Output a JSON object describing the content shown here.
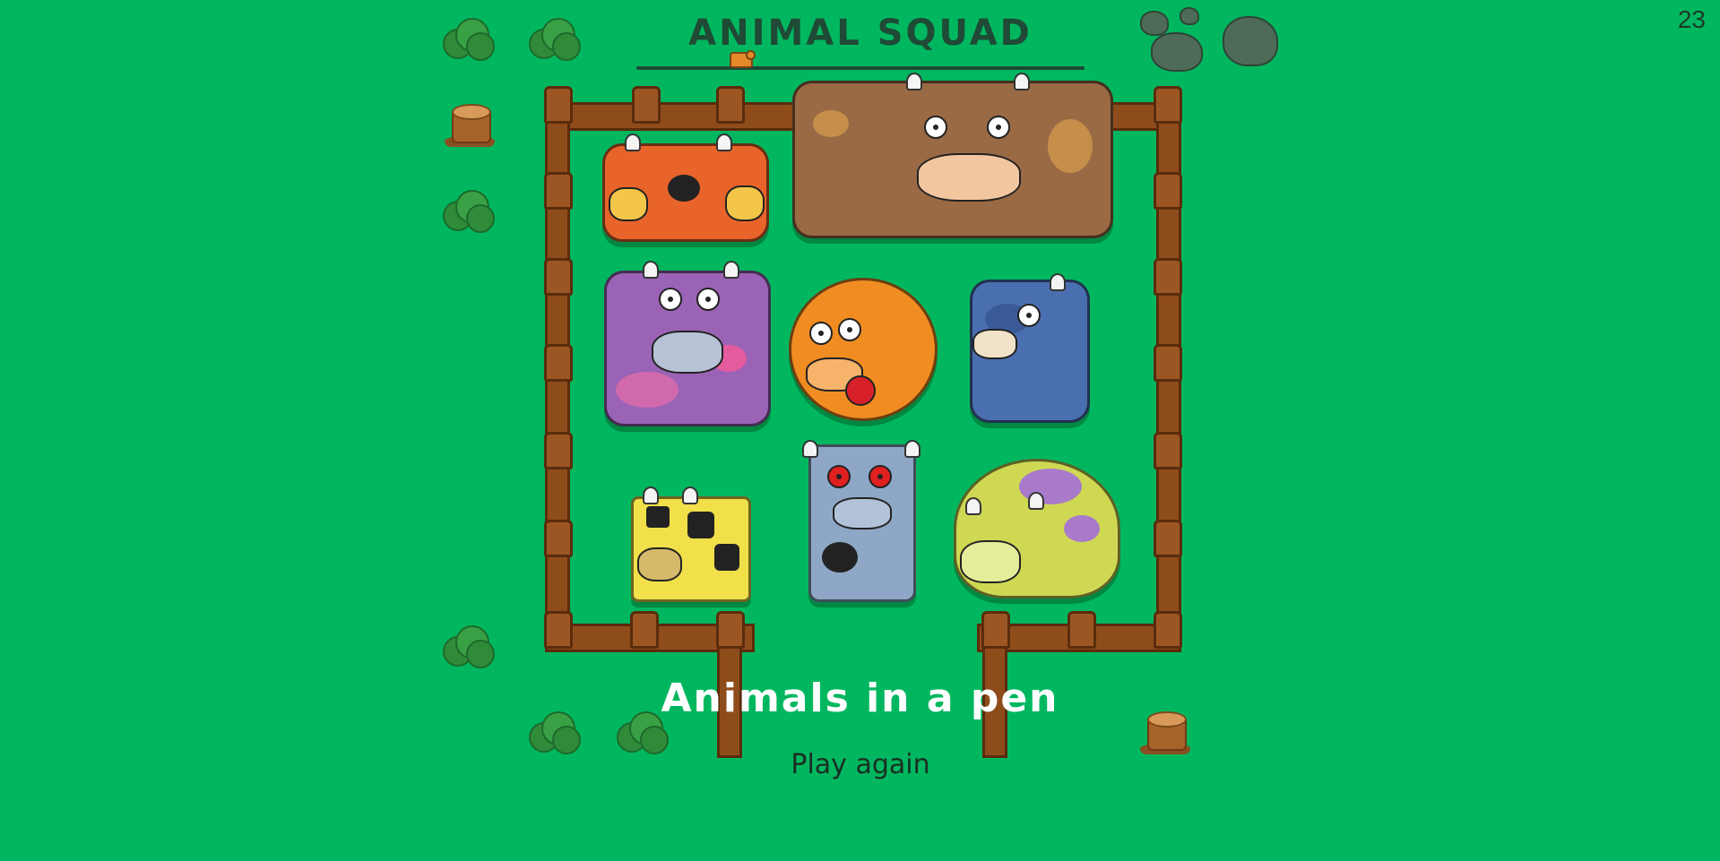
{
  "game": {
    "title": "ANIMAL SQUAD",
    "counter": "23",
    "progress": 0.23
  },
  "result": {
    "message": "Animals in a pen",
    "play_again_label": "Play again"
  },
  "animals": [
    {
      "name": "two-headed-orange-cow",
      "color": "#e8642a"
    },
    {
      "name": "big-brown-cow",
      "color": "#9a6a45"
    },
    {
      "name": "purple-cow",
      "color": "#9a63b5"
    },
    {
      "name": "orange-round-cow",
      "color": "#f08c22"
    },
    {
      "name": "blue-patterned-cow",
      "color": "#4a6fb0"
    },
    {
      "name": "yellow-spotted-cow",
      "color": "#f1e049"
    },
    {
      "name": "robot-cow",
      "color": "#8ea7c6"
    },
    {
      "name": "yellow-green-cow",
      "color": "#cfd853"
    }
  ],
  "colors": {
    "background": "#00b75f",
    "title": "#1f4a35",
    "fence": "#8f4c1b"
  }
}
